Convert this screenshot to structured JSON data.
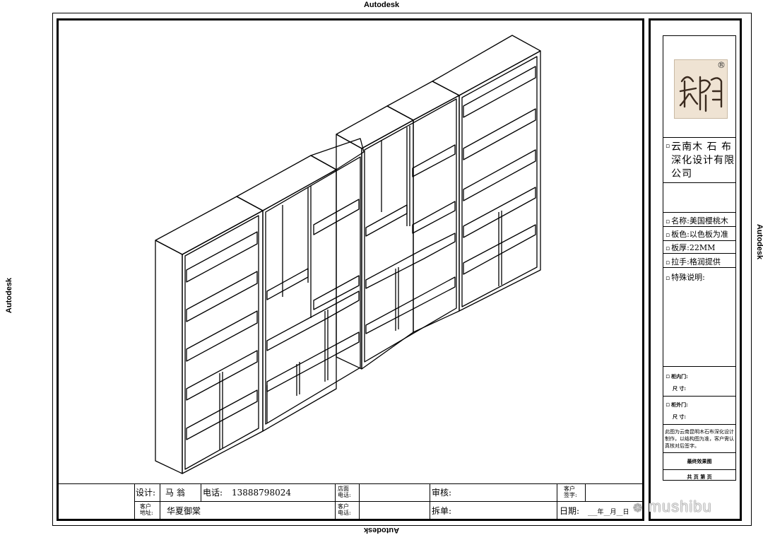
{
  "watermarks": {
    "autodesk": "Autodesk"
  },
  "title_block": {
    "design_label": "设计:",
    "designer": "马  翁",
    "phone_label": "电话:",
    "phone": "13888798024",
    "store_phone_label_1": "店面",
    "store_phone_label_2": "电话:",
    "review_label": "审核:",
    "customer_sign_label_1": "客户",
    "customer_sign_label_2": "签字:",
    "customer_addr_label_1": "客户",
    "customer_addr_label_2": "地址:",
    "customer_addr": "华夏御棠",
    "customer_phone_label_1": "客户",
    "customer_phone_label_2": "电话:",
    "split_label": "拆单:",
    "date_label": "日期:",
    "date_value": "___年__月__日"
  },
  "side_panel": {
    "company": "云南木 石 布 深化设计有限公司",
    "fields": [
      {
        "label": "名称:",
        "value": "美国樱桃木"
      },
      {
        "label": "板色:",
        "value": "以色板为准"
      },
      {
        "label": "板厚:",
        "value": "22MM"
      },
      {
        "label": "拉手:",
        "value": "格润提供"
      },
      {
        "label": "特殊说明:",
        "value": ""
      }
    ],
    "inner_door_label": "柜内门:",
    "inner_door_size": "尺 寸:",
    "outer_door_label": "柜外门:",
    "outer_door_size": "尺 寸:",
    "note": "此图为云南昆明木石布深化设计制作，以结构图为准，客户需认真核对后签字。",
    "drawing_name": "最终效果图",
    "page_info": "共  页  第  页"
  },
  "social_watermark": "mushibu",
  "logo": {
    "registered_mark": "®"
  }
}
